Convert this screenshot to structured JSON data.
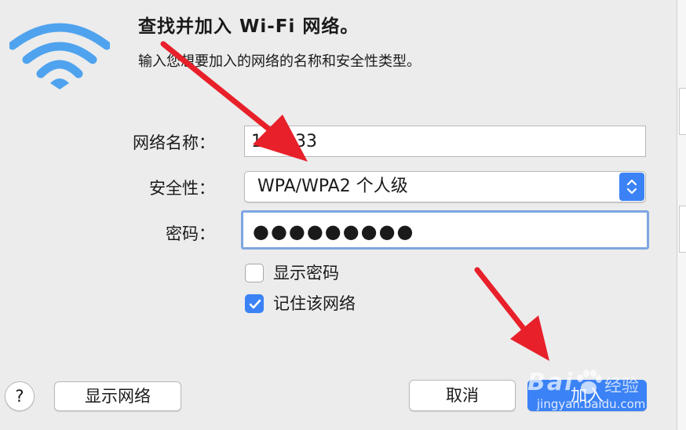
{
  "dialog": {
    "title": "查找并加入 Wi-Fi 网络。",
    "subtitle": "输入您想要加入的网络的名称和安全性类型。",
    "icon": "wifi-icon"
  },
  "form": {
    "network_name_label": "网络名称：",
    "network_name_value": "112233",
    "security_label": "安全性：",
    "security_value": "WPA/WPA2 个人级",
    "password_label": "密码：",
    "password_value": "●●●●●●●●●"
  },
  "options": {
    "show_password": {
      "label": "显示密码",
      "checked": false
    },
    "remember_network": {
      "label": "记住该网络",
      "checked": true
    }
  },
  "buttons": {
    "help": "?",
    "show_networks": "显示网络",
    "cancel": "取消",
    "join": "加入"
  },
  "watermark": {
    "brand": "Bai",
    "brand_suffix": "经验",
    "url": "jingyan.baidu.com"
  },
  "colors": {
    "accent": "#3b82f6",
    "arrow": "#e8202a",
    "wifi": "#4fa3ee"
  }
}
